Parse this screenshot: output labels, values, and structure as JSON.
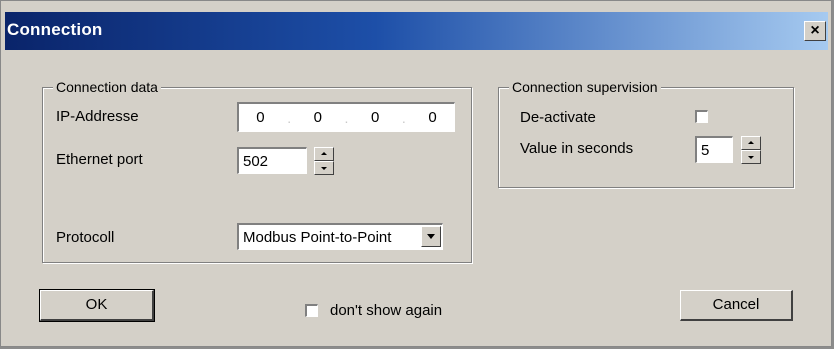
{
  "dialog": {
    "title": "Connection",
    "close_label": "×"
  },
  "connection_data": {
    "legend": "Connection data",
    "ip_label": "IP-Addresse",
    "ip_octets": [
      "0",
      "0",
      "0",
      "0"
    ],
    "ip_separator": ".",
    "port_label": "Ethernet port",
    "port_value": "502",
    "protocol_label": "Protocoll",
    "protocol_value": "Modbus Point-to-Point"
  },
  "supervision": {
    "legend": "Connection supervision",
    "deactivate_label": "De-activate",
    "deactivate_checked": false,
    "seconds_label": "Value in seconds",
    "seconds_value": "5"
  },
  "footer": {
    "ok_label": "OK",
    "dont_show_label": "don't show again",
    "dont_show_checked": false,
    "cancel_label": "Cancel"
  },
  "icons": {
    "close": "close-icon",
    "spin_up": "arrow-up-icon",
    "spin_down": "arrow-down-icon",
    "dropdown": "chevron-down-icon"
  },
  "colors": {
    "titlebar_start": "#0a246a",
    "titlebar_end": "#a6caf0",
    "dialog_face": "#d4d0c8"
  }
}
